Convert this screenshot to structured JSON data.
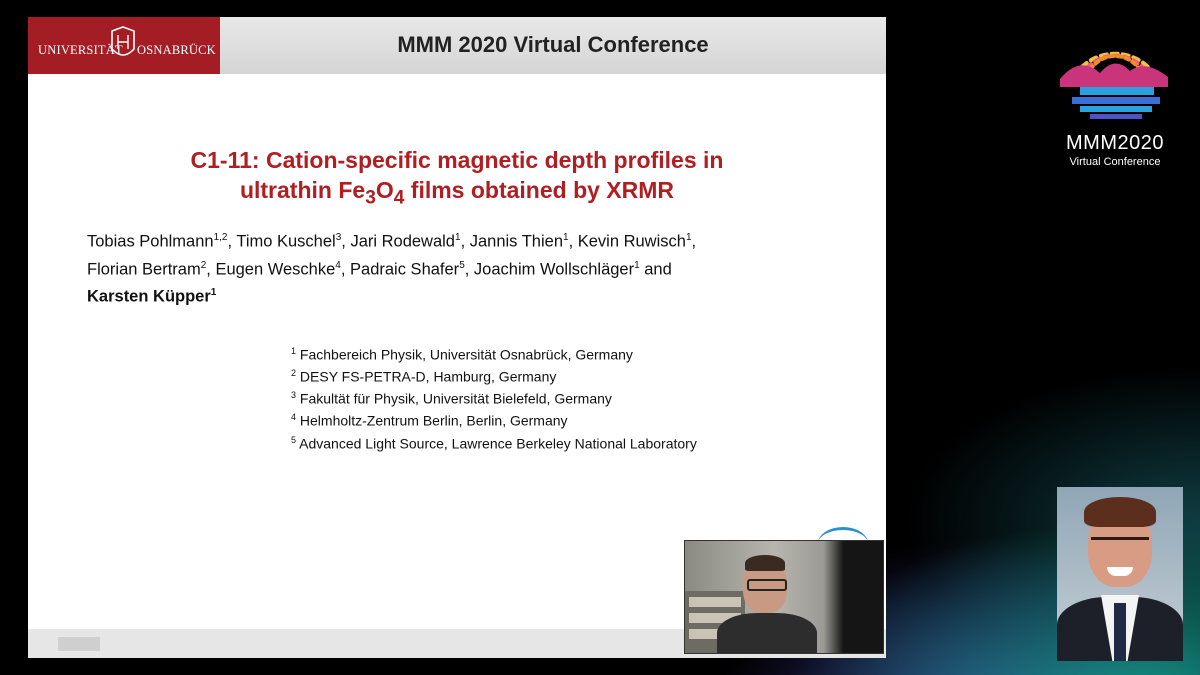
{
  "header": {
    "university_left": "UNIVERSITÄT",
    "university_right": "OSNABRÜCK",
    "conference_title": "MMM 2020 Virtual Conference"
  },
  "talk": {
    "title_line1": "C1-11: Cation-specific magnetic depth profiles in",
    "title_line2_pre": "ultrathin Fe",
    "title_line2_sub1": "3",
    "title_line2_mid": "O",
    "title_line2_sub2": "4",
    "title_line2_post": " films obtained by XRMR"
  },
  "authors": [
    {
      "name": "Tobias Pohlmann",
      "sup": "1,2",
      "sep": ", "
    },
    {
      "name": "Timo Kuschel",
      "sup": "3",
      "sep": ", "
    },
    {
      "name": "Jari Rodewald",
      "sup": "1",
      "sep": ",  "
    },
    {
      "name": "Jannis Thien",
      "sup": "1",
      "sep": ", "
    },
    {
      "name": "Kevin Ruwisch",
      "sup": "1",
      "sep": ","
    },
    {
      "name": "Florian Bertram",
      "sup": "2",
      "sep": ", "
    },
    {
      "name": "Eugen Weschke",
      "sup": "4",
      "sep": ", "
    },
    {
      "name": "Padraic Shafer",
      "sup": "5",
      "sep": ", "
    },
    {
      "name": "Joachim Wollschläger",
      "sup": "1",
      "sep": " and"
    },
    {
      "name": "Karsten Küpper",
      "sup": "1",
      "sep": ""
    }
  ],
  "affiliations": [
    {
      "num": "1",
      "text": "Fachbereich Physik, Universität Osnabrück, Germany"
    },
    {
      "num": "2",
      "text": "DESY FS-PETRA-D, Hamburg, Germany"
    },
    {
      "num": "3",
      "text": "Fakultät für Physik, Universität Bielefeld, Germany"
    },
    {
      "num": "4",
      "text": "Helmholtz-Zentrum Berlin, Berlin, Germany"
    },
    {
      "num": "5",
      "text": "Advanced Light Source, Lawrence Berkeley National Laboratory"
    }
  ],
  "conference_logo": {
    "title": "MMM2020",
    "subtitle": "Virtual Conference"
  },
  "colors": {
    "title_red": "#b01e22",
    "university_red": "#a51d24"
  }
}
